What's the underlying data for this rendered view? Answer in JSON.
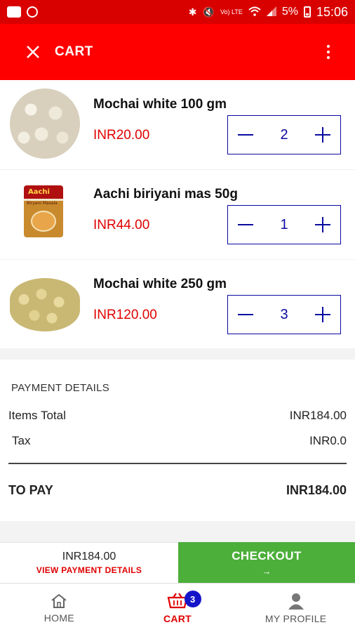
{
  "status_bar": {
    "signal_text": "Vo) LTE",
    "battery": "5%",
    "time": "15:06"
  },
  "header": {
    "title": "CART"
  },
  "cart_items": [
    {
      "name": "Mochai white 100 gm",
      "price": "INR20.00",
      "quantity": "2"
    },
    {
      "name": "Aachi biriyani mas 50g",
      "price": "INR44.00",
      "quantity": "1",
      "image_brand": "Aachi",
      "image_subtitle": "Biryani Masala"
    },
    {
      "name": "Mochai white 250 gm",
      "price": "INR120.00",
      "quantity": "3"
    }
  ],
  "payment": {
    "heading": "PAYMENT DETAILS",
    "items_total_label": "Items Total",
    "items_total_value": "INR184.00",
    "tax_label": "Tax",
    "tax_value": "INR0.0",
    "to_pay_label": "TO PAY",
    "to_pay_value": "INR184.00"
  },
  "checkout": {
    "total": "INR184.00",
    "view_details_label": "VIEW PAYMENT DETAILS",
    "button_label": "CHECKOUT",
    "arrow": "→"
  },
  "bottom_nav": {
    "home_label": "HOME",
    "cart_label": "CART",
    "cart_badge": "3",
    "profile_label": "MY PROFILE"
  },
  "colors": {
    "header": "#ff0000",
    "status_bar": "#d90000",
    "price": "#e00000",
    "qty_border": "#0a0aa0",
    "checkout": "#4caf3a",
    "badge": "#1515c8"
  },
  "icons": [
    "close-icon",
    "more-vert-icon",
    "bluetooth-icon",
    "mute-icon",
    "wifi-icon",
    "signal-icon",
    "battery-icon",
    "home-icon",
    "cart-icon",
    "profile-icon"
  ]
}
